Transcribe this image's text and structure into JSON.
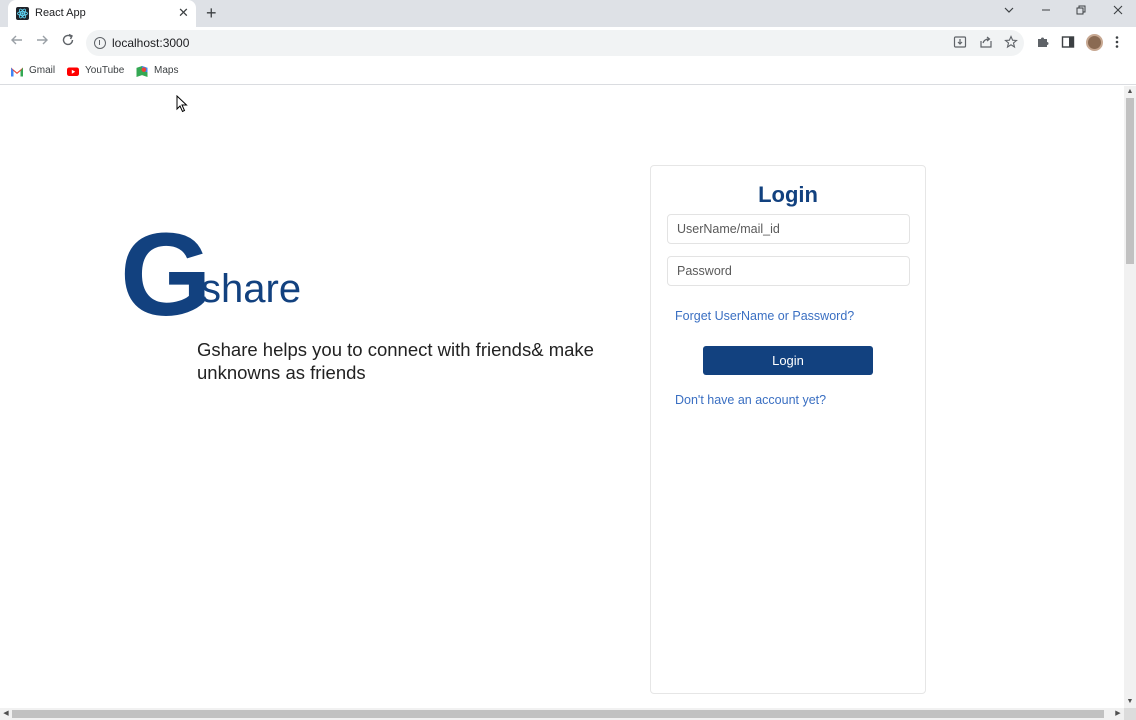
{
  "browser": {
    "tab_title": "React App",
    "tab_close": "✕",
    "newtab": "+",
    "url": "localhost:3000",
    "bookmarks": [
      {
        "label": "Gmail"
      },
      {
        "label": "YouTube"
      },
      {
        "label": "Maps"
      }
    ],
    "colors": {
      "tabstrip": "#dee1e6",
      "omnibox": "#f1f3f4"
    }
  },
  "app": {
    "logo_letter": "G",
    "logo_word": "share",
    "tagline": "Gshare helps you to connect with friends& make unknowns as friends",
    "brand_color": "#12417f"
  },
  "login": {
    "title": "Login",
    "username_placeholder": "UserName/mail_id",
    "password_placeholder": "Password",
    "forgot_link": "Forget UserName or Password?",
    "button_label": "Login",
    "signup_link": "Don't have an account yet?",
    "link_color": "#3a6fc2"
  }
}
